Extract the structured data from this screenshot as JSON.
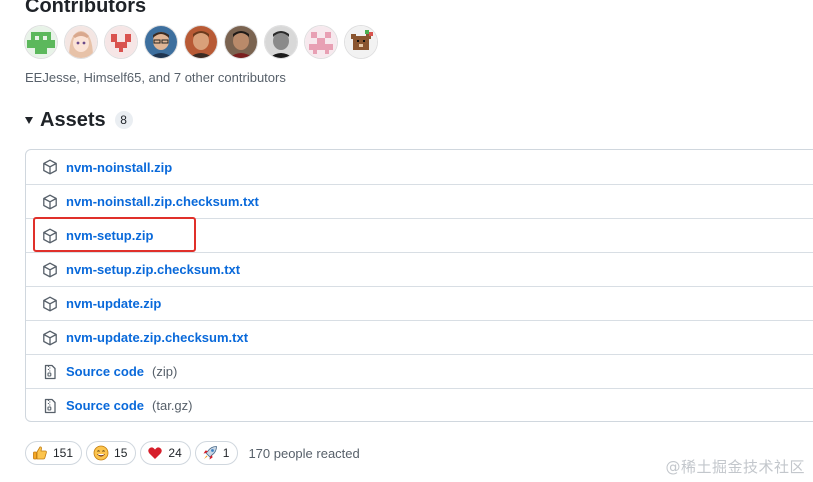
{
  "contributors": {
    "title": "Contributors",
    "summary": "EEJesse, Himself65, and 7 other contributors",
    "avatars": [
      {
        "name": "avatar-identicon-green",
        "color": "#5cb85c"
      },
      {
        "name": "avatar-anime-girl",
        "color": "#e9c8c0"
      },
      {
        "name": "avatar-identicon-red",
        "color": "#d9534f"
      },
      {
        "name": "avatar-photo-man-glasses",
        "color": "#3a6ea5"
      },
      {
        "name": "avatar-photo-man-red",
        "color": "#a0522d"
      },
      {
        "name": "avatar-photo-man-dark",
        "color": "#5a4a3f"
      },
      {
        "name": "avatar-photo-bw",
        "color": "#555555"
      },
      {
        "name": "avatar-identicon-pink",
        "color": "#e8a0b4"
      },
      {
        "name": "avatar-pixel-bear",
        "color": "#7a4a2a"
      }
    ]
  },
  "assets": {
    "title": "Assets",
    "count": "8",
    "items": [
      {
        "label": "nvm-noinstall.zip",
        "ext": "",
        "icon": "package-icon"
      },
      {
        "label": "nvm-noinstall.zip.checksum.txt",
        "ext": "",
        "icon": "package-icon"
      },
      {
        "label": "nvm-setup.zip",
        "ext": "",
        "icon": "package-icon"
      },
      {
        "label": "nvm-setup.zip.checksum.txt",
        "ext": "",
        "icon": "package-icon"
      },
      {
        "label": "nvm-update.zip",
        "ext": "",
        "icon": "package-icon"
      },
      {
        "label": "nvm-update.zip.checksum.txt",
        "ext": "",
        "icon": "package-icon"
      },
      {
        "label": "Source code",
        "ext": "(zip)",
        "icon": "file-zip-icon"
      },
      {
        "label": "Source code",
        "ext": "(tar.gz)",
        "icon": "file-zip-icon"
      }
    ]
  },
  "reactions": {
    "items": [
      {
        "emoji": "thumbs-up-icon",
        "count": "151"
      },
      {
        "emoji": "laugh-icon",
        "count": "15"
      },
      {
        "emoji": "heart-icon",
        "count": "24"
      },
      {
        "emoji": "rocket-icon",
        "count": "1"
      }
    ],
    "summary": "170 people reacted"
  },
  "watermark": "@稀土掘金技术社区",
  "colors": {
    "link": "#0969da",
    "highlight": "#e0302a",
    "border": "#d0d7de"
  }
}
